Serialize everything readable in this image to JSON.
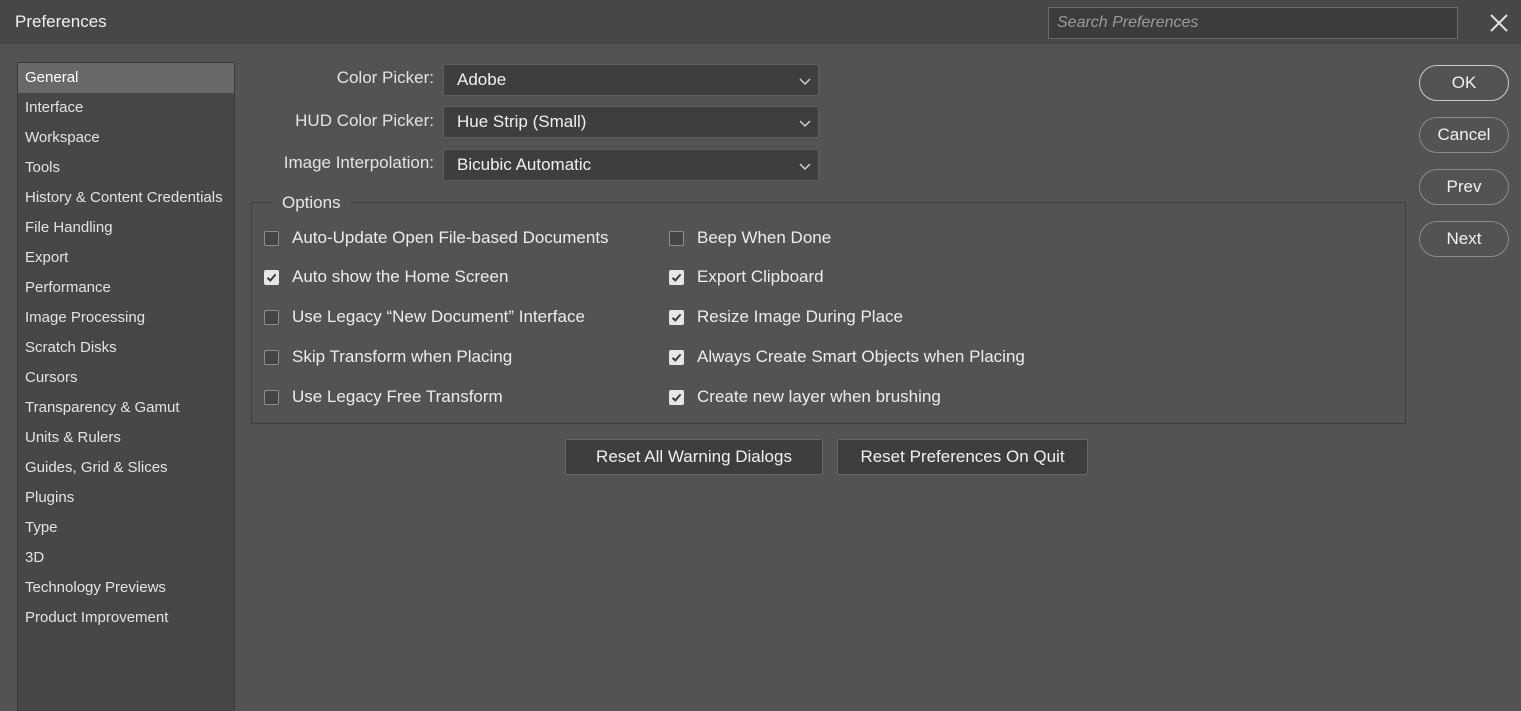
{
  "window": {
    "title": "Preferences"
  },
  "search": {
    "placeholder": "Search Preferences"
  },
  "sidebar": {
    "items": [
      {
        "label": "General",
        "active": true
      },
      {
        "label": "Interface"
      },
      {
        "label": "Workspace"
      },
      {
        "label": "Tools"
      },
      {
        "label": "History & Content Credentials"
      },
      {
        "label": "File Handling"
      },
      {
        "label": "Export"
      },
      {
        "label": "Performance"
      },
      {
        "label": "Image Processing"
      },
      {
        "label": "Scratch Disks"
      },
      {
        "label": "Cursors"
      },
      {
        "label": "Transparency & Gamut"
      },
      {
        "label": "Units & Rulers"
      },
      {
        "label": "Guides, Grid & Slices"
      },
      {
        "label": "Plugins"
      },
      {
        "label": "Type"
      },
      {
        "label": "3D"
      },
      {
        "label": "Technology Previews"
      },
      {
        "label": "Product Improvement"
      }
    ]
  },
  "general": {
    "color_picker": {
      "label": "Color Picker:",
      "value": "Adobe"
    },
    "hud_color_picker": {
      "label": "HUD Color Picker:",
      "value": "Hue Strip (Small)"
    },
    "image_interpolation": {
      "label": "Image Interpolation:",
      "value": "Bicubic Automatic"
    }
  },
  "options": {
    "title": "Options",
    "left": [
      {
        "label": "Auto-Update Open File-based Documents",
        "checked": false
      },
      {
        "label": "Auto show the Home Screen",
        "checked": true
      },
      {
        "label": "Use Legacy “New Document” Interface",
        "checked": false
      },
      {
        "label": "Skip Transform when Placing",
        "checked": false
      },
      {
        "label": "Use Legacy Free Transform",
        "checked": false
      }
    ],
    "right": [
      {
        "label": "Beep When Done",
        "checked": false
      },
      {
        "label": "Export Clipboard",
        "checked": true
      },
      {
        "label": "Resize Image During Place",
        "checked": true
      },
      {
        "label": "Always Create Smart Objects when Placing",
        "checked": true
      },
      {
        "label": "Create new layer when brushing",
        "checked": true
      }
    ]
  },
  "buttons": {
    "reset_warnings": "Reset All Warning Dialogs",
    "reset_prefs": "Reset Preferences On Quit",
    "ok": "OK",
    "cancel": "Cancel",
    "prev": "Prev",
    "next": "Next"
  },
  "colors": {
    "background": "#535353",
    "sidebar_bg": "#474747",
    "active_item": "#696969",
    "checkbox_checked": "#e6e6e6"
  }
}
